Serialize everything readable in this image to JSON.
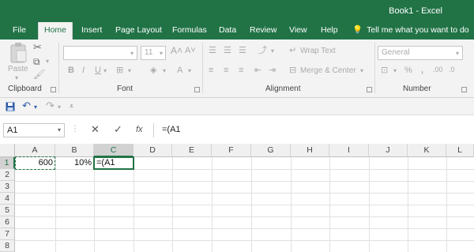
{
  "app": {
    "title": "Book1  -  Excel"
  },
  "tabs": [
    {
      "label": "File"
    },
    {
      "label": "Home"
    },
    {
      "label": "Insert"
    },
    {
      "label": "Page Layout"
    },
    {
      "label": "Formulas"
    },
    {
      "label": "Data"
    },
    {
      "label": "Review"
    },
    {
      "label": "View"
    },
    {
      "label": "Help"
    }
  ],
  "tell_me": "Tell me what you want to do",
  "ribbon": {
    "clipboard": {
      "paste": "Paste",
      "label": "Clipboard"
    },
    "font": {
      "size": "11",
      "label": "Font"
    },
    "alignment": {
      "wrap_text": "Wrap Text",
      "merge_center": "Merge & Center",
      "label": "Alignment"
    },
    "number": {
      "format": "General",
      "label": "Number"
    }
  },
  "formula_bar": {
    "name_box": "A1",
    "cancel": "✕",
    "enter": "✓",
    "fx": "fx",
    "content": "=(A1"
  },
  "grid": {
    "columns": [
      "A",
      "B",
      "C",
      "D",
      "E",
      "F",
      "G",
      "H",
      "I",
      "J",
      "K",
      "L"
    ],
    "rows": [
      "1",
      "2",
      "3",
      "4",
      "5",
      "6",
      "7",
      "8"
    ],
    "cells": {
      "A1": "600",
      "B1": "10%",
      "C1": "=(A1"
    }
  },
  "colors": {
    "accent": "#217346"
  }
}
